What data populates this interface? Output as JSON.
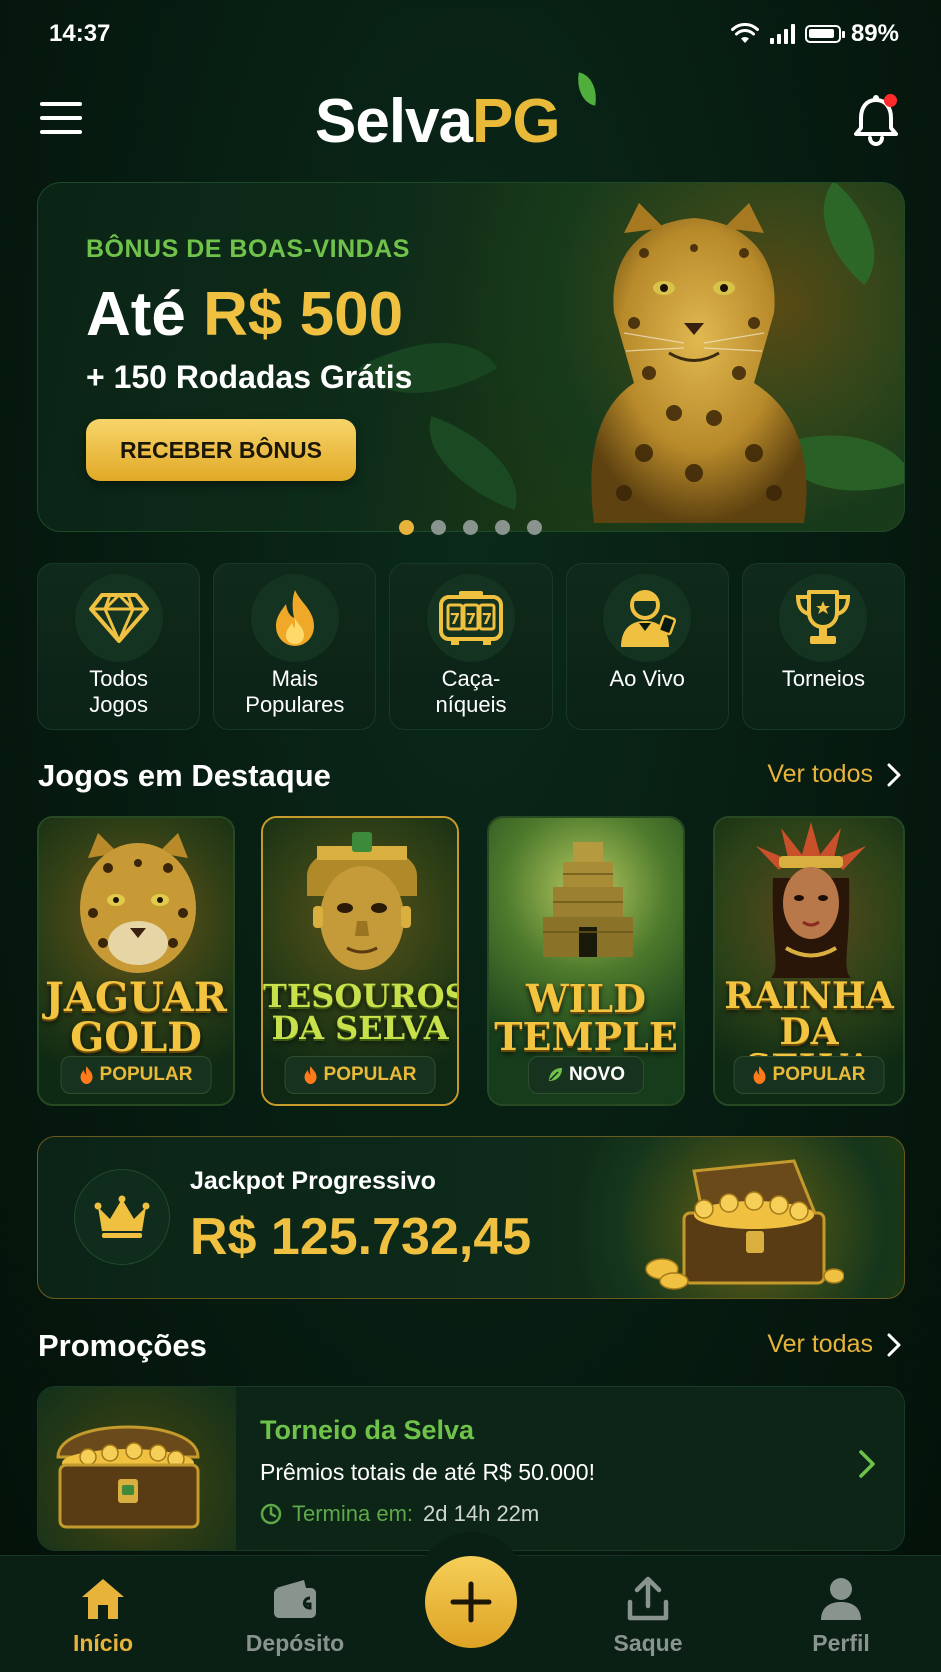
{
  "status_bar": {
    "time": "14:37",
    "battery": "89%"
  },
  "header": {
    "logo_white": "Selva",
    "logo_gold": "PG"
  },
  "banner": {
    "kicker": "BÔNUS DE BOAS-VINDAS",
    "title_prefix": "Até ",
    "title_amount": "R$ 500",
    "subtitle": "+ 150 Rodadas Grátis",
    "cta": "RECEBER BÔNUS",
    "slides_total": 5,
    "slide_active": 1
  },
  "categories": [
    {
      "label": "Todos\nJogos",
      "icon": "diamond-icon"
    },
    {
      "label": "Mais\nPopulares",
      "icon": "fire-icon"
    },
    {
      "label": "Caça-\nníqueis",
      "icon": "slot-machine-icon"
    },
    {
      "label": "Ao Vivo",
      "icon": "live-dealer-icon"
    },
    {
      "label": "Torneios",
      "icon": "trophy-icon"
    }
  ],
  "featured": {
    "title": "Jogos em Destaque",
    "link": "Ver todos",
    "games": [
      {
        "line1": "JAGUAR",
        "line2": "GOLD",
        "badge": "POPULAR",
        "badge_icon": "fire-icon"
      },
      {
        "line1": "TESOUROS",
        "line2": "DA SELVA",
        "badge": "POPULAR",
        "badge_icon": "fire-icon"
      },
      {
        "line1": "WILD",
        "line2": "TEMPLE",
        "badge": "NOVO",
        "badge_icon": "leaf-icon"
      },
      {
        "line1": "RAINHA",
        "line2": "DA SELVA",
        "badge": "POPULAR",
        "badge_icon": "fire-icon"
      }
    ]
  },
  "jackpot": {
    "label": "Jackpot Progressivo",
    "value": "R$ 125.732,45"
  },
  "promotions": {
    "title": "Promoções",
    "link": "Ver todas",
    "items": [
      {
        "title": "Torneio da Selva",
        "description": "Prêmios totais de até R$ 50.000!",
        "ends_label": "Termina em:",
        "ends_value": "2d 14h 22m"
      }
    ]
  },
  "bottom_nav": [
    {
      "label": "Início",
      "icon": "home-icon",
      "active": true
    },
    {
      "label": "Depósito",
      "icon": "wallet-icon",
      "active": false
    },
    {
      "label": "Saque",
      "icon": "upload-icon",
      "active": false
    },
    {
      "label": "Perfil",
      "icon": "user-icon",
      "active": false
    }
  ],
  "colors": {
    "gold": "#e8b33a",
    "green": "#6fc24a",
    "background": "#061a10"
  }
}
